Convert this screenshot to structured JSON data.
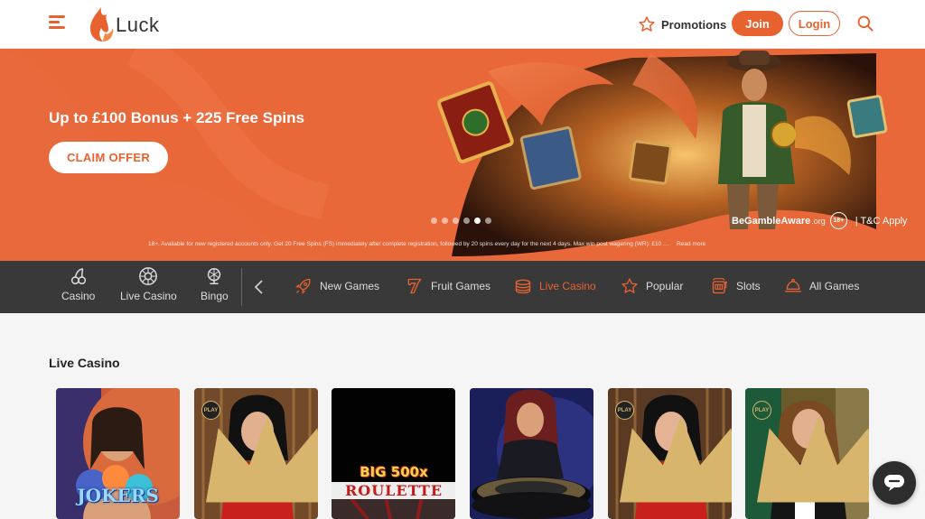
{
  "header": {
    "logo_text": "Luck",
    "promotions_label": "Promotions",
    "join_label": "Join",
    "login_label": "Login",
    "icons": [
      "hamburger-icon",
      "flame-logo-icon",
      "star-icon",
      "search-icon"
    ]
  },
  "hero": {
    "headline": "Up to £100 Bonus + 225 Free Spins",
    "cta_label": "CLAIM OFFER",
    "slide_count": 6,
    "active_slide": 5,
    "gamble_aware": "BeGambleAware",
    "gamble_aware_suffix": ".org",
    "age_badge": "18+",
    "tc_label": "| T&C Apply",
    "disclaimer": "18+. Available for new registered accounts only. Get 20 Free Spins (FS) immediately after complete registration, followed by 20 spins every day for the next 4 days. Max win post wagering (WR): £10 ....",
    "read_more": "Read more"
  },
  "nav": {
    "main": [
      {
        "label": "Casino",
        "icon": "cherries-icon"
      },
      {
        "label": "Live Casino",
        "icon": "roulette-wheel-icon"
      },
      {
        "label": "Bingo",
        "icon": "bingo-globe-icon"
      }
    ],
    "categories": [
      {
        "label": "New Games",
        "icon": "rocket-icon"
      },
      {
        "label": "Fruit Games",
        "icon": "seven-icon"
      },
      {
        "label": "Live Casino",
        "icon": "chips-icon",
        "active": true
      },
      {
        "label": "Popular",
        "icon": "star-icon"
      },
      {
        "label": "Slots",
        "icon": "slot-machine-icon"
      },
      {
        "label": "All Games",
        "icon": "cloche-icon"
      }
    ]
  },
  "section": {
    "title": "Live Casino",
    "cards": [
      {
        "badge": "",
        "logo": "JOKERS"
      },
      {
        "badge": "PLAY",
        "logo": ""
      },
      {
        "badge": "",
        "logo": "BIG 500x ROULETTE"
      },
      {
        "badge": "",
        "logo": ""
      },
      {
        "badge": "PLAY",
        "logo": ""
      },
      {
        "badge": "PLAY",
        "logo": ""
      }
    ],
    "card3_line1": "BIG 500x",
    "card3_line2": "ROULETTE",
    "card1_logo": "JOKERS"
  },
  "colors": {
    "brand": "#e8622f",
    "hero_bg": "#e8683a",
    "nav_bg": "#393939"
  }
}
